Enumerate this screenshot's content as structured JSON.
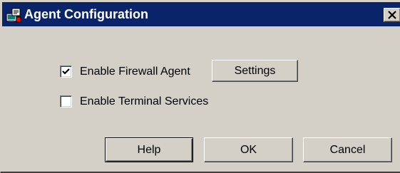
{
  "window": {
    "title": "Agent Configuration",
    "app_icon": "agent-computer-icon",
    "close_icon": "close-icon"
  },
  "options": {
    "firewall_agent": {
      "label": "Enable Firewall Agent",
      "checked": true
    },
    "terminal_services": {
      "label": "Enable Terminal Services",
      "checked": false
    }
  },
  "buttons": {
    "settings": "Settings",
    "help": "Help",
    "ok": "OK",
    "cancel": "Cancel"
  },
  "colors": {
    "title_bar": "#0a246a",
    "dialog_face": "#d4d0c8"
  }
}
